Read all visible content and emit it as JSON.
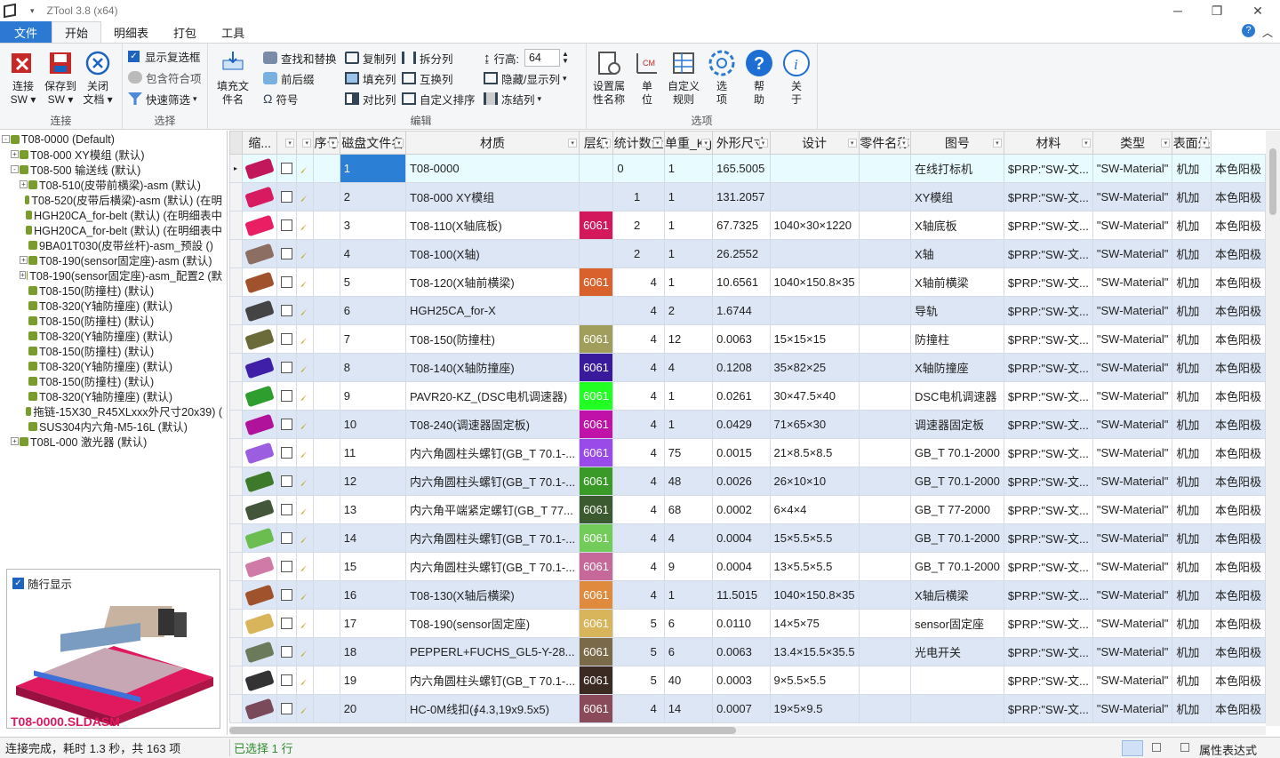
{
  "window": {
    "title": "ZTool 3.8  (x64)"
  },
  "menu": {
    "tabs": [
      "文件",
      "开始",
      "明细表",
      "打包",
      "工具"
    ]
  },
  "ribbon": {
    "connect": {
      "label": "连接",
      "btn1": "连接\nSW",
      "btn2": "保存到\nSW",
      "btn3": "关闭\n文档"
    },
    "select": {
      "label": "选择",
      "show_checkbox": "显示复选框",
      "include_parts": "包含符合项",
      "quick_filter": "快速筛选"
    },
    "fill_name": "填充文\n件名",
    "edit": {
      "label": "编辑",
      "find_replace": "查找和替换",
      "prefix_suffix": "前后缀",
      "symbol": "符号",
      "copy_col": "复制列",
      "fill_col": "填充列",
      "compare_col": "对比列",
      "split_col": "拆分列",
      "swap_col": "互换列",
      "custom_sort": "自定义排序",
      "row_height_label": "行高:",
      "row_height": "64",
      "hide_show_col": "隐藏/显示列",
      "freeze_col": "冻结列"
    },
    "options": {
      "label": "选项",
      "set_prop": "设置属\n性名称",
      "unit": "单\n位",
      "custom_rule": "自定义\n规则",
      "option": "选\n项",
      "help": "帮\n助",
      "about": "关\n于"
    }
  },
  "tree": [
    {
      "t": "T08-0000 (Default)",
      "d": 0,
      "pm": "-"
    },
    {
      "t": "T08-000 XY模组 (默认)",
      "d": 1,
      "pm": "+"
    },
    {
      "t": "T08-500 输送线 (默认)",
      "d": 1,
      "pm": "-"
    },
    {
      "t": "T08-510(皮带前横梁)-asm (默认)",
      "d": 2,
      "pm": "+"
    },
    {
      "t": "T08-520(皮带后横梁)-asm (默认) (在明",
      "d": 2,
      "pm": ""
    },
    {
      "t": "HGH20CA_for-belt (默认) (在明细表中",
      "d": 2,
      "pm": ""
    },
    {
      "t": "HGH20CA_for-belt (默认) (在明细表中",
      "d": 2,
      "pm": ""
    },
    {
      "t": "9BA01T030(皮带丝杆)-asm_预設 ()",
      "d": 2,
      "pm": ""
    },
    {
      "t": "T08-190(sensor固定座)-asm (默认)",
      "d": 2,
      "pm": "+"
    },
    {
      "t": "T08-190(sensor固定座)-asm_配置2 (默",
      "d": 2,
      "pm": "+"
    },
    {
      "t": "T08-150(防撞柱) (默认)",
      "d": 2,
      "pm": ""
    },
    {
      "t": "T08-320(Y轴防撞座) (默认)",
      "d": 2,
      "pm": ""
    },
    {
      "t": "T08-150(防撞柱) (默认)",
      "d": 2,
      "pm": ""
    },
    {
      "t": "T08-320(Y轴防撞座) (默认)",
      "d": 2,
      "pm": ""
    },
    {
      "t": "T08-150(防撞柱) (默认)",
      "d": 2,
      "pm": ""
    },
    {
      "t": "T08-320(Y轴防撞座) (默认)",
      "d": 2,
      "pm": ""
    },
    {
      "t": "T08-150(防撞柱) (默认)",
      "d": 2,
      "pm": ""
    },
    {
      "t": "T08-320(Y轴防撞座) (默认)",
      "d": 2,
      "pm": ""
    },
    {
      "t": "拖链-15X30_R45XLxxx外尺寸20x39) (",
      "d": 2,
      "pm": ""
    },
    {
      "t": "SUS304内六角-M5-16L (默认)",
      "d": 2,
      "pm": ""
    },
    {
      "t": "T08L-000 激光器 (默认)",
      "d": 1,
      "pm": "+"
    }
  ],
  "preview": {
    "checkbox_label": "随行显示",
    "filename": "T08-0000.SLDASM"
  },
  "columns": [
    "缩...",
    "",
    "",
    "序号",
    "磁盘文件名",
    "材质",
    "层级",
    "统计数量",
    "单重_Kg",
    "外形尺寸",
    "设计",
    "零件名称",
    "图号",
    "材料",
    "类型",
    "表面处"
  ],
  "rows": [
    {
      "n": "1",
      "file": "T08-0000",
      "mat": "",
      "mc": "",
      "lvl": "0",
      "qty": "1",
      "w": "165.5005",
      "dim": "",
      "name": "在线打标机",
      "draw": "$PRP:\"SW-文...",
      "mat2": "\"SW-Material\"",
      "type": "机加",
      "surf": "本色阳极",
      "thumb": "#c2185b"
    },
    {
      "n": "2",
      "file": "T08-000 XY模组",
      "mat": "",
      "mc": "",
      "lvl": "1",
      "qty": "1",
      "w": "131.2057",
      "dim": "",
      "name": "XY模组",
      "draw": "$PRP:\"SW-文...",
      "mat2": "\"SW-Material\"",
      "type": "机加",
      "surf": "本色阳极",
      "thumb": "#d81b60"
    },
    {
      "n": "3",
      "file": "T08-110(X轴底板)",
      "mat": "6061",
      "mc": "#d4185c",
      "lvl": "2",
      "qty": "1",
      "w": "67.7325",
      "dim": "1040×30×1220",
      "name": "X轴底板",
      "draw": "$PRP:\"SW-文...",
      "mat2": "\"SW-Material\"",
      "type": "机加",
      "surf": "本色阳极",
      "thumb": "#e91e63"
    },
    {
      "n": "4",
      "file": "T08-100(X轴)",
      "mat": "",
      "mc": "",
      "lvl": "2",
      "qty": "1",
      "w": "26.2552",
      "dim": "",
      "name": "X轴",
      "draw": "$PRP:\"SW-文...",
      "mat2": "\"SW-Material\"",
      "type": "机加",
      "surf": "本色阳极",
      "thumb": "#8d6e63"
    },
    {
      "n": "5",
      "file": "T08-120(X轴前横梁)",
      "mat": "6061",
      "mc": "#d8612c",
      "lvl": "4",
      "qty": "1",
      "w": "10.6561",
      "dim": "1040×150.8×35",
      "name": "X轴前横梁",
      "draw": "$PRP:\"SW-文...",
      "mat2": "\"SW-Material\"",
      "type": "机加",
      "surf": "本色阳极",
      "thumb": "#a0522d"
    },
    {
      "n": "6",
      "file": "HGH25CA_for-X",
      "mat": "",
      "mc": "",
      "lvl": "4",
      "qty": "2",
      "w": "1.6744",
      "dim": "",
      "name": "导轨",
      "draw": "$PRP:\"SW-文...",
      "mat2": "\"SW-Material\"",
      "type": "机加",
      "surf": "本色阳极",
      "thumb": "#444444"
    },
    {
      "n": "7",
      "file": "T08-150(防撞柱)",
      "mat": "6061",
      "mc": "#a09e5a",
      "lvl": "4",
      "qty": "12",
      "w": "0.0063",
      "dim": "15×15×15",
      "name": "防撞柱",
      "draw": "$PRP:\"SW-文...",
      "mat2": "\"SW-Material\"",
      "type": "机加",
      "surf": "本色阳极",
      "thumb": "#6b6b3a"
    },
    {
      "n": "8",
      "file": "T08-140(X轴防撞座)",
      "mat": "6061",
      "mc": "#3a1a9c",
      "lvl": "4",
      "qty": "4",
      "w": "0.1208",
      "dim": "35×82×25",
      "name": "X轴防撞座",
      "draw": "$PRP:\"SW-文...",
      "mat2": "\"SW-Material\"",
      "type": "机加",
      "surf": "本色阳极",
      "thumb": "#3f1fa8"
    },
    {
      "n": "9",
      "file": "PAVR20-KZ_(DSC电机调速器)",
      "mat": "6061",
      "mc": "#22ff22",
      "lvl": "4",
      "qty": "1",
      "w": "0.0261",
      "dim": "30×47.5×40",
      "name": "DSC电机调速器",
      "draw": "$PRP:\"SW-文...",
      "mat2": "\"SW-Material\"",
      "type": "机加",
      "surf": "本色阳极",
      "thumb": "#2e9e2e"
    },
    {
      "n": "10",
      "file": "T08-240(调速器固定板)",
      "mat": "6061",
      "mc": "#c012a8",
      "lvl": "4",
      "qty": "1",
      "w": "0.0429",
      "dim": "71×65×30",
      "name": "调速器固定板",
      "draw": "$PRP:\"SW-文...",
      "mat2": "\"SW-Material\"",
      "type": "机加",
      "surf": "本色阳极",
      "thumb": "#b0129c"
    },
    {
      "n": "11",
      "file": "内六角圆柱头螺钉(GB_T 70.1-...",
      "mat": "6061",
      "mc": "#9a4ae8",
      "lvl": "4",
      "qty": "75",
      "w": "0.0015",
      "dim": "21×8.5×8.5",
      "name": "GB_T 70.1-2000",
      "draw": "$PRP:\"SW-文...",
      "mat2": "\"SW-Material\"",
      "type": "机加",
      "surf": "本色阳极",
      "thumb": "#9c5ee0"
    },
    {
      "n": "12",
      "file": "内六角圆柱头螺钉(GB_T 70.1-...",
      "mat": "6061",
      "mc": "#3a9a28",
      "lvl": "4",
      "qty": "48",
      "w": "0.0026",
      "dim": "26×10×10",
      "name": "GB_T 70.1-2000",
      "draw": "$PRP:\"SW-文...",
      "mat2": "\"SW-Material\"",
      "type": "机加",
      "surf": "本色阳极",
      "thumb": "#3d7a2a"
    },
    {
      "n": "13",
      "file": "内六角平端紧定螺钉(GB_T 77...",
      "mat": "6061",
      "mc": "#3c5a30",
      "lvl": "4",
      "qty": "68",
      "w": "0.0002",
      "dim": "6×4×4",
      "name": "GB_T 77-2000",
      "draw": "$PRP:\"SW-文...",
      "mat2": "\"SW-Material\"",
      "type": "机加",
      "surf": "本色阳极",
      "thumb": "#44563a"
    },
    {
      "n": "14",
      "file": "内六角圆柱头螺钉(GB_T 70.1-...",
      "mat": "6061",
      "mc": "#72cc5a",
      "lvl": "4",
      "qty": "4",
      "w": "0.0004",
      "dim": "15×5.5×5.5",
      "name": "GB_T 70.1-2000",
      "draw": "$PRP:\"SW-文...",
      "mat2": "\"SW-Material\"",
      "type": "机加",
      "surf": "本色阳极",
      "thumb": "#6abd4e"
    },
    {
      "n": "15",
      "file": "内六角圆柱头螺钉(GB_T 70.1-...",
      "mat": "6061",
      "mc": "#c6689a",
      "lvl": "4",
      "qty": "9",
      "w": "0.0004",
      "dim": "13×5.5×5.5",
      "name": "GB_T 70.1-2000",
      "draw": "$PRP:\"SW-文...",
      "mat2": "\"SW-Material\"",
      "type": "机加",
      "surf": "本色阳极",
      "thumb": "#d07aa8"
    },
    {
      "n": "16",
      "file": "T08-130(X轴后横梁)",
      "mat": "6061",
      "mc": "#e08a3e",
      "lvl": "4",
      "qty": "1",
      "w": "11.5015",
      "dim": "1040×150.8×35",
      "name": "X轴后横梁",
      "draw": "$PRP:\"SW-文...",
      "mat2": "\"SW-Material\"",
      "type": "机加",
      "surf": "本色阳极",
      "thumb": "#a0522d"
    },
    {
      "n": "17",
      "file": "T08-190(sensor固定座)",
      "mat": "6061",
      "mc": "#d8b45a",
      "lvl": "5",
      "qty": "6",
      "w": "0.0110",
      "dim": "14×5×75",
      "name": "sensor固定座",
      "draw": "$PRP:\"SW-文...",
      "mat2": "\"SW-Material\"",
      "type": "机加",
      "surf": "本色阳极",
      "thumb": "#d8b45a"
    },
    {
      "n": "18",
      "file": "PEPPERL+FUCHS_GL5-Y-28...",
      "mat": "6061",
      "mc": "#7a6a4a",
      "lvl": "5",
      "qty": "6",
      "w": "0.0063",
      "dim": "13.4×15.5×35.5",
      "name": "光电开关",
      "draw": "$PRP:\"SW-文...",
      "mat2": "\"SW-Material\"",
      "type": "机加",
      "surf": "本色阳极",
      "thumb": "#6b7a5a"
    },
    {
      "n": "19",
      "file": "内六角圆柱头螺钉(GB_T 70.1-...",
      "mat": "6061",
      "mc": "#3a2a22",
      "lvl": "5",
      "qty": "40",
      "w": "0.0003",
      "dim": "9×5.5×5.5",
      "name": "",
      "draw": "$PRP:\"SW-文...",
      "mat2": "\"SW-Material\"",
      "type": "机加",
      "surf": "本色阳极",
      "thumb": "#333333"
    },
    {
      "n": "20",
      "file": "HC-0M线扣(∮4.3,19x9.5x5)",
      "mat": "6061",
      "mc": "#8a4a5a",
      "lvl": "4",
      "qty": "14",
      "w": "0.0007",
      "dim": "19×5×9.5",
      "name": "",
      "draw": "$PRP:\"SW-文...",
      "mat2": "\"SW-Material\"",
      "type": "机加",
      "surf": "本色阳极",
      "thumb": "#7a4a5a"
    }
  ],
  "status": {
    "left": "连接完成，耗时 1.3 秒，共 163 项",
    "selected": "已选择 1 行",
    "right": "属性表达式"
  }
}
